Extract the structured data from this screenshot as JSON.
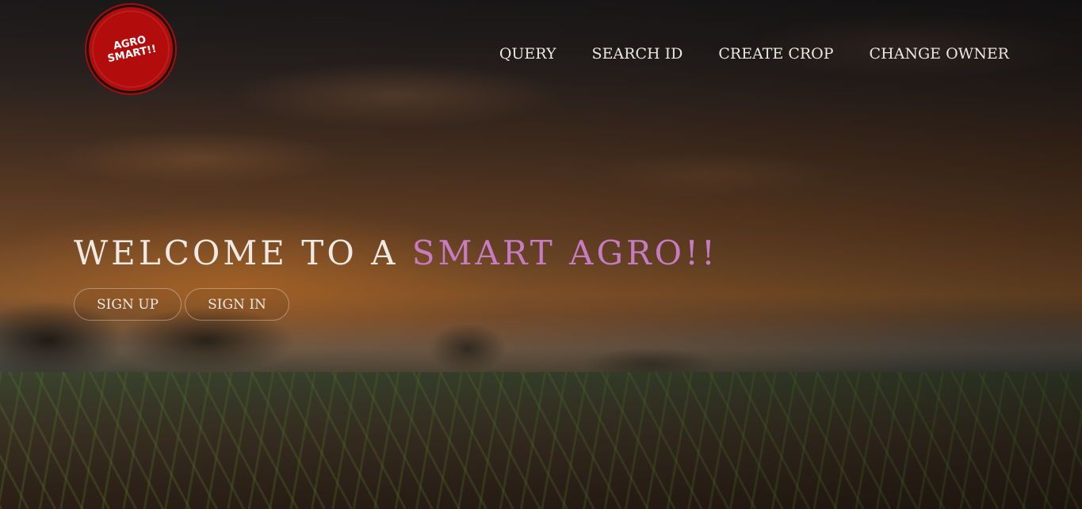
{
  "logo": {
    "text": "AGRO\nSMART!!"
  },
  "nav": {
    "items": [
      {
        "label": "QUERY"
      },
      {
        "label": "SEARCH ID"
      },
      {
        "label": "CREATE CROP"
      },
      {
        "label": "CHANGE OWNER"
      }
    ]
  },
  "hero": {
    "headline_prefix": "WELCOME TO A ",
    "headline_accent": "SMART AGRO!!",
    "signup_label": "SIGN UP",
    "signin_label": "SIGN IN"
  },
  "colors": {
    "accent": "#c67cc3",
    "logo_red": "#b30c0c",
    "text": "#efe9e4"
  }
}
